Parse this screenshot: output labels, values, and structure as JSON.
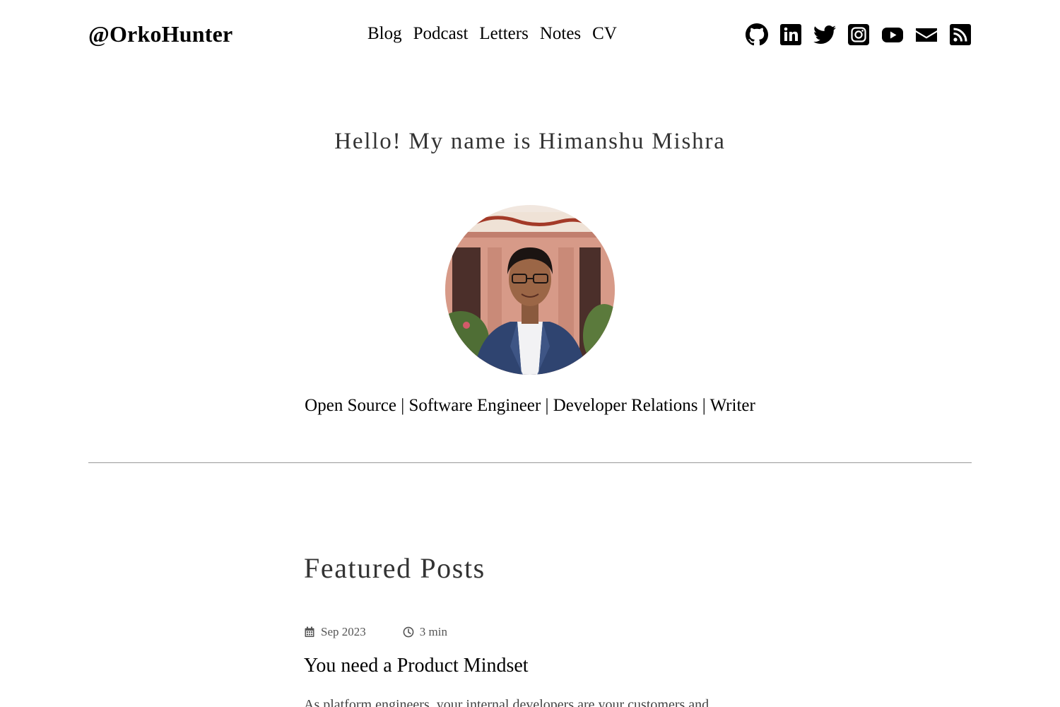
{
  "header": {
    "site_title": "@OrkoHunter",
    "nav": [
      {
        "label": "Blog"
      },
      {
        "label": "Podcast"
      },
      {
        "label": "Letters"
      },
      {
        "label": "Notes"
      },
      {
        "label": "CV"
      }
    ],
    "social_icons": [
      "github-icon",
      "linkedin-icon",
      "twitter-icon",
      "instagram-icon",
      "youtube-icon",
      "email-icon",
      "rss-icon"
    ]
  },
  "hero": {
    "greeting": "Hello! My name is Himanshu Mishra",
    "tagline": "Open Source | Software Engineer | Developer Relations | Writer"
  },
  "featured": {
    "heading": "Featured Posts",
    "posts": [
      {
        "date": "Sep 2023",
        "read_time": "3 min",
        "title": "You need a Product Mindset",
        "excerpt": "As platform engineers, your internal developers are your customers and"
      }
    ]
  },
  "colors": {
    "text": "#000000",
    "muted": "#555555",
    "heading": "#333333",
    "divider": "#999999"
  }
}
